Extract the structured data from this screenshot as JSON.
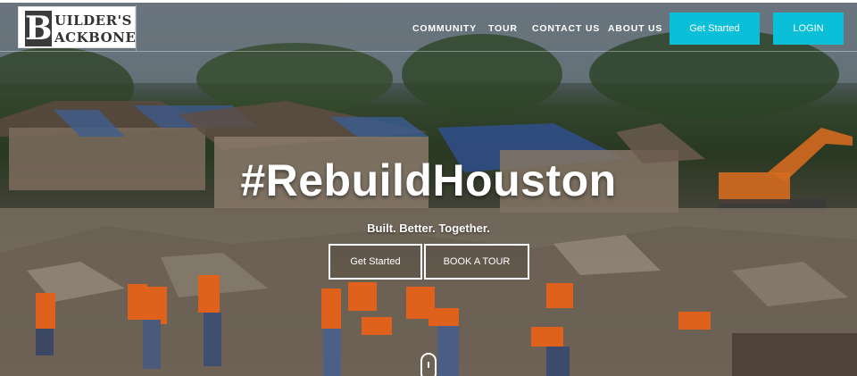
{
  "brand": {
    "logo_initial": "B",
    "logo_line1": "UILDER'S",
    "logo_line2": "ACKBONE"
  },
  "nav": {
    "items": [
      {
        "label": "COMMUNITY"
      },
      {
        "label": "TOUR"
      },
      {
        "label": "CONTACT US"
      },
      {
        "label": "ABOUT US"
      }
    ],
    "get_started_label": "Get Started",
    "login_label": "LOGIN"
  },
  "hero": {
    "title": "#RebuildHouston",
    "subtitle": "Built. Better. Together.",
    "primary_button": "Get Started",
    "secondary_button": "BOOK A TOUR"
  },
  "colors": {
    "accent": "#0bbfd9",
    "overlay": "rgba(0,0,0,0.35)",
    "text": "#ffffff"
  },
  "icons": {
    "scroll": "mouse-scroll-icon"
  }
}
